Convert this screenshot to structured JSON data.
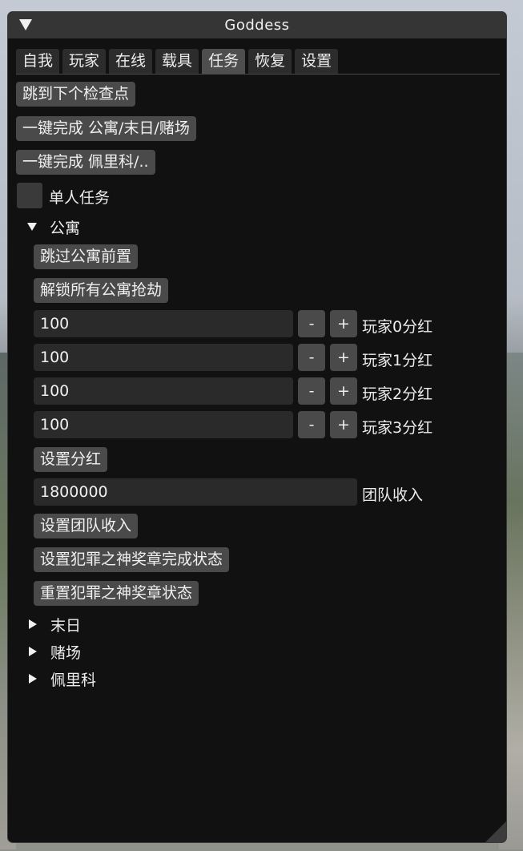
{
  "window": {
    "title": "Goddess"
  },
  "tabs": [
    {
      "label": "自我"
    },
    {
      "label": "玩家"
    },
    {
      "label": "在线"
    },
    {
      "label": "载具"
    },
    {
      "label": "任务",
      "active": true
    },
    {
      "label": "恢复"
    },
    {
      "label": "设置"
    }
  ],
  "buttons": {
    "skip_checkpoint": "跳到下个检查点",
    "complete_apartment": "一键完成 公寓/末日/赌场",
    "complete_perico": "一键完成 佩里科/.."
  },
  "solo_mission": {
    "label": "单人任务",
    "checked": false
  },
  "apartment": {
    "label": "公寓",
    "expanded": true,
    "skip_setup": "跳过公寓前置",
    "unlock_heists": "解锁所有公寓抢劫",
    "cuts": [
      {
        "value": "100",
        "label": "玩家0分红"
      },
      {
        "value": "100",
        "label": "玩家1分红"
      },
      {
        "value": "100",
        "label": "玩家2分红"
      },
      {
        "value": "100",
        "label": "玩家3分红"
      }
    ],
    "minus": "-",
    "plus": "+",
    "set_cuts": "设置分红",
    "team_income": {
      "value": "1800000",
      "label": "团队收入"
    },
    "set_team_income": "设置团队收入",
    "set_criminal_mastermind": "设置犯罪之神奖章完成状态",
    "reset_criminal_mastermind": "重置犯罪之神奖章状态"
  },
  "collapsed_nodes": [
    {
      "label": "末日"
    },
    {
      "label": "赌场"
    },
    {
      "label": "佩里科"
    }
  ]
}
